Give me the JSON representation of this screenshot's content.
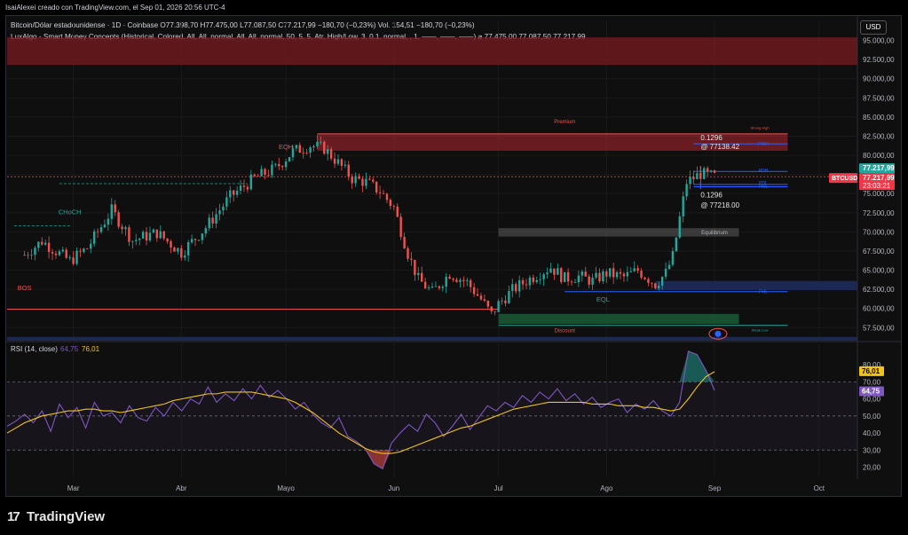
{
  "header": {
    "snapshot": "IsaiAlexei creado con TradingView.com, el Sep 01, 2026 20:56 UTC-4",
    "symbol_line": "Bitcoin/Dólar estadounidense · 1D · Coinbase  O77.398,70  H77.475,00  L77.087,50  C77.217,99  −180,70 (−0,23%)  Vol. 154,51  −180,70 (−0,23%)",
    "indicator_line": "LuxAlgo - Smart Money Concepts (Historical, Colored, All, All, normal, All, All, normal, 50, 5, 5, Atr, High/Low, 3, 0,1, normal, , 1, ——, ——, ——)  ⌀  77.475,00  77.087,50  77.217,99",
    "currency": "USD",
    "logo": "TradingView"
  },
  "colors": {
    "up": "#26a69a",
    "down": "#ef5350",
    "rsi": "#7e57c2",
    "rsi_ma": "#f0c419",
    "premium": "#b22833",
    "discount": "#1b5e3a",
    "equilibrium": "#555555"
  },
  "chart_data": [
    {
      "type": "candlestick",
      "title": "Bitcoin/Dólar estadounidense · 1D · Coinbase",
      "ylabel": "USD",
      "ylim": [
        55800,
        97500
      ],
      "y_ticks": [
        "57.500,00",
        "60.000,00",
        "62.500,00",
        "65.000,00",
        "67.500,00",
        "70.000,00",
        "72.500,00",
        "75.000,00",
        "77.500,00",
        "80.000,00",
        "82.500,00",
        "85.000,00",
        "87.500,00",
        "90.000,00",
        "92.500,00",
        "95.000,00"
      ],
      "x_ticks": [
        "Mar",
        "Abr",
        "Mayo",
        "Jun",
        "Jul",
        "Ago",
        "Sep",
        "Oct"
      ],
      "price_badges": {
        "last": "77.217,99",
        "symbol": "BTCUSD",
        "price": "77.217,99",
        "countdown": "23:03:21"
      },
      "key_closes": [
        [
          "Feb 15",
          67000
        ],
        [
          "Feb 20",
          68800
        ],
        [
          "Feb 28",
          66200
        ],
        [
          "Mar 05",
          67900
        ],
        [
          "Mar 12",
          72800
        ],
        [
          "Mar 18",
          68900
        ],
        [
          "Mar 25",
          69900
        ],
        [
          "Apr 01",
          67300
        ],
        [
          "Apr 08",
          70600
        ],
        [
          "Apr 15",
          74600
        ],
        [
          "Apr 22",
          77000
        ],
        [
          "Apr 28",
          78300
        ],
        [
          "May 03",
          80500
        ],
        [
          "May 08",
          81300
        ],
        [
          "May 12",
          80900
        ],
        [
          "May 16",
          79000
        ],
        [
          "May 20",
          77000
        ],
        [
          "May 24",
          76500
        ],
        [
          "May 28",
          75300
        ],
        [
          "Jun 01",
          73200
        ],
        [
          "Jun 05",
          67200
        ],
        [
          "Jun 08",
          63800
        ],
        [
          "Jun 12",
          62100
        ],
        [
          "Jun 17",
          64600
        ],
        [
          "Jun 22",
          63400
        ],
        [
          "Jun 26",
          61200
        ],
        [
          "Jun 29",
          59200
        ],
        [
          "Jul 01",
          60600
        ],
        [
          "Jul 05",
          62400
        ],
        [
          "Jul 10",
          63900
        ],
        [
          "Jul 16",
          65400
        ],
        [
          "Jul 20",
          63900
        ],
        [
          "Jul 24",
          64200
        ],
        [
          "Jul 28",
          63600
        ],
        [
          "Aug 01",
          64600
        ],
        [
          "Aug 06",
          64100
        ],
        [
          "Aug 10",
          65000
        ],
        [
          "Aug 15",
          63200
        ],
        [
          "Aug 18",
          64600
        ],
        [
          "Aug 20",
          66800
        ],
        [
          "Aug 22",
          71800
        ],
        [
          "Aug 24",
          76500
        ],
        [
          "Aug 28",
          77600
        ],
        [
          "Sep 01",
          77218
        ]
      ],
      "annotations": [
        {
          "text": "Premium",
          "kind": "zone"
        },
        {
          "text": "Equilibrium",
          "kind": "zone"
        },
        {
          "text": "Discount",
          "kind": "zone"
        },
        {
          "text": "Strong High",
          "kind": "level"
        },
        {
          "text": "Weak Low",
          "kind": "level"
        },
        {
          "text": "PWH",
          "kind": "level"
        },
        {
          "text": "PDH",
          "kind": "level"
        },
        {
          "text": "PDL",
          "kind": "level"
        },
        {
          "text": "PWL",
          "kind": "level"
        },
        {
          "text": "PHL",
          "kind": "level"
        },
        {
          "text": "BOS",
          "kind": "structure"
        },
        {
          "text": "CHoCH",
          "kind": "structure"
        },
        {
          "text": "EQH",
          "kind": "structure"
        },
        {
          "text": "EQL",
          "kind": "structure"
        },
        {
          "text": "0.1296",
          "kind": "fib"
        },
        {
          "text": "@ 77138.42",
          "kind": "fib"
        },
        {
          "text": "0.1296",
          "kind": "fib"
        },
        {
          "text": "@ 77218.00",
          "kind": "fib"
        }
      ]
    },
    {
      "type": "line",
      "title": "RSI (14, close)",
      "series": [
        {
          "name": "RSI",
          "last": "64,75",
          "values": [
            44,
            47,
            51,
            46,
            53,
            41,
            57,
            49,
            55,
            43,
            58,
            50,
            52,
            46,
            56,
            49,
            47,
            55,
            50,
            58,
            53,
            60,
            57,
            67,
            58,
            63,
            59,
            66,
            60,
            68,
            61,
            65,
            60,
            54,
            58,
            51,
            46,
            43,
            49,
            38,
            35,
            31,
            22,
            19,
            34,
            40,
            45,
            41,
            51,
            46,
            38,
            44,
            51,
            42,
            49,
            56,
            53,
            58,
            55,
            62,
            58,
            64,
            60,
            66,
            59,
            63,
            57,
            61,
            55,
            58,
            60,
            52,
            57,
            54,
            59,
            53,
            50,
            58,
            88,
            86,
            77,
            65
          ]
        },
        {
          "name": "RSI MA",
          "last": "76,01",
          "values": [
            40,
            43,
            46,
            48,
            50,
            51,
            52,
            53,
            53,
            54,
            54,
            53,
            53,
            52,
            53,
            54,
            55,
            56,
            57,
            59,
            60,
            61,
            62,
            63,
            63,
            64,
            64,
            64,
            64,
            63,
            62,
            61,
            60,
            58,
            55,
            52,
            48,
            44,
            40,
            37,
            34,
            31,
            29,
            28,
            28,
            29,
            31,
            33,
            35,
            37,
            39,
            41,
            43,
            44,
            46,
            48,
            50,
            52,
            54,
            55,
            56,
            57,
            58,
            58,
            58,
            58,
            58,
            57,
            57,
            57,
            56,
            56,
            56,
            55,
            55,
            54,
            53,
            54,
            60,
            67,
            73,
            76
          ]
        }
      ],
      "ylim": [
        14,
        90
      ],
      "y_ticks": [
        "20,00",
        "30,00",
        "40,00",
        "50,00",
        "60,00",
        "70,00",
        "80,00"
      ],
      "levels": [
        30,
        50,
        70
      ]
    }
  ]
}
